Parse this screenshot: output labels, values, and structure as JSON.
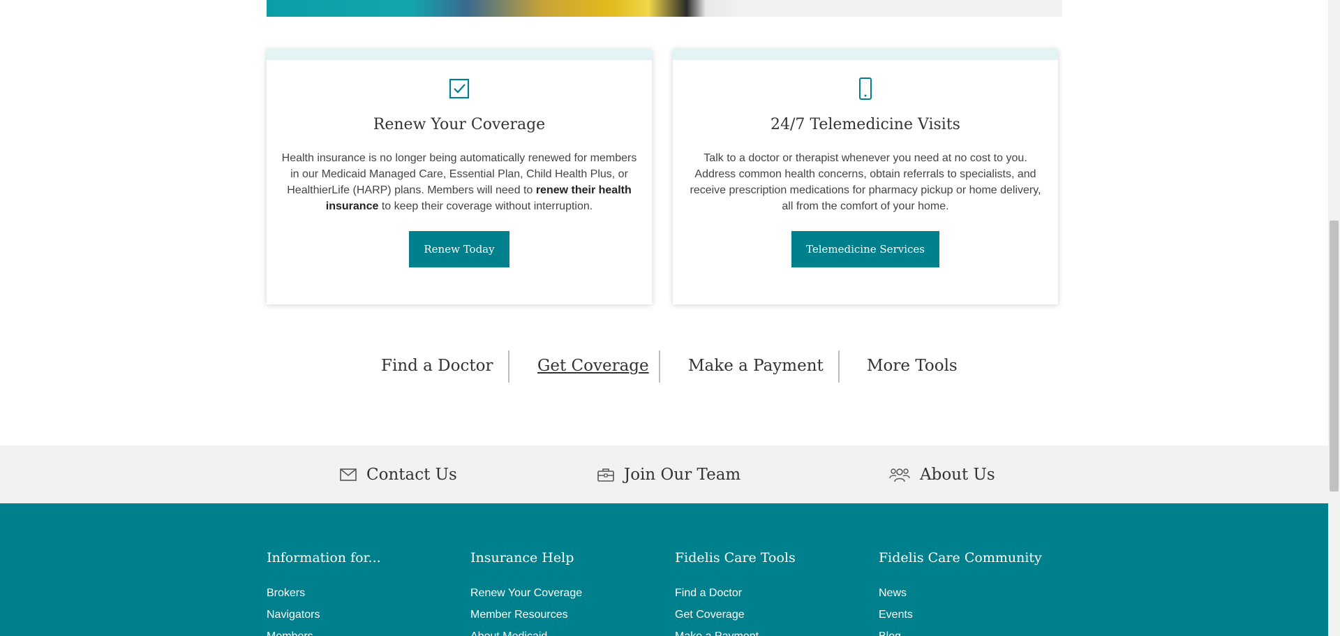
{
  "cards": [
    {
      "title": "Renew Your Coverage",
      "icon": "checkbox-icon",
      "body_before": "Health insurance is no longer being automatically renewed for members in our Medicaid Managed Care, Essential Plan, Child Health Plus, or HealthierLife (HARP) plans. Members will need to ",
      "body_bold": "renew their health insurance",
      "body_after": " to keep their coverage without interruption.",
      "button": "Renew Today"
    },
    {
      "title": "24/7 Telemedicine Visits",
      "icon": "smartphone-icon",
      "body": "Talk to a doctor or therapist whenever you need at no cost to you. Address common health concerns, obtain referrals to specialists, and receive prescription medications for pharmacy pickup or home delivery, all from the comfort of your home.",
      "button": "Telemedicine Services"
    }
  ],
  "quick_links": [
    "Find a Doctor",
    "Get Coverage",
    "Make a Payment",
    "More Tools"
  ],
  "band": {
    "contact": "Contact Us",
    "join": "Join Our Team",
    "about": "About Us"
  },
  "footer": {
    "columns": [
      {
        "heading": "Information for...",
        "items": [
          "Brokers",
          "Navigators",
          "Members"
        ]
      },
      {
        "heading": "Insurance Help",
        "items": [
          "Renew Your Coverage",
          "Member Resources",
          "About Medicaid"
        ]
      },
      {
        "heading": "Fidelis Care Tools",
        "items": [
          "Find a Doctor",
          "Get Coverage",
          "Make a Payment"
        ]
      },
      {
        "heading": "Fidelis Care Community",
        "items": [
          "News",
          "Events",
          "Blog"
        ]
      }
    ]
  },
  "colors": {
    "primary": "#00808c",
    "strip": "#e4f4f4",
    "band": "#f2f2f2"
  }
}
